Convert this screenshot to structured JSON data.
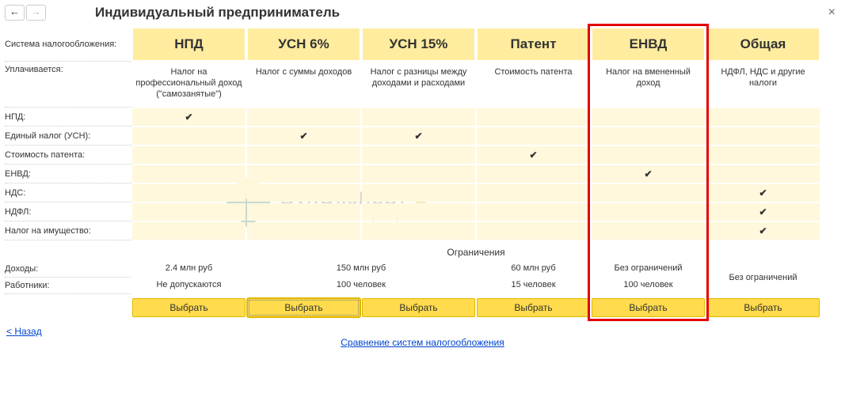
{
  "nav": {
    "back": "←",
    "fwd": "→"
  },
  "title": "Индивидуальный предприниматель",
  "close": "×",
  "row_labels": {
    "system": "Система налогообложения:",
    "paid": "Уплачивается:",
    "npd": "НПД:",
    "usn": "Единый налог (УСН):",
    "patent_cost": "Стоимость патента:",
    "envd": "ЕНВД:",
    "nds": "НДС:",
    "ndfl": "НДФЛ:",
    "property": "Налог на имущество:",
    "income": "Доходы:",
    "workers": "Работники:"
  },
  "limits_header": "Ограничения",
  "columns": [
    {
      "id": "npd",
      "header": "НПД",
      "desc": "Налог на профессиональный доход (\"самозанятые\")",
      "marks": {
        "npd": true
      },
      "income": "2.4 млн руб",
      "workers": "Не допускаются",
      "btn": "Выбрать"
    },
    {
      "id": "usn6",
      "header": "УСН 6%",
      "desc": "Налог с суммы доходов",
      "marks": {
        "usn": true
      },
      "income": "150 млн руб",
      "workers": "100 человек",
      "btn": "Выбрать"
    },
    {
      "id": "usn15",
      "header": "УСН 15%",
      "desc": "Налог с разницы между доходами и расходами",
      "marks": {
        "usn": true
      },
      "income": "",
      "workers": "",
      "btn": "Выбрать"
    },
    {
      "id": "patent",
      "header": "Патент",
      "desc": "Стоимость патента",
      "marks": {
        "patent_cost": true
      },
      "income": "60 млн руб",
      "workers": "15 человек",
      "btn": "Выбрать"
    },
    {
      "id": "envd",
      "header": "ЕНВД",
      "desc": "Налог на вмененный доход",
      "marks": {
        "envd": true
      },
      "income": "Без ограничений",
      "workers": "100 человек",
      "btn": "Выбрать"
    },
    {
      "id": "general",
      "header": "Общая",
      "desc": "НДФЛ, НДС и другие налоги",
      "marks": {
        "nds": true,
        "ndfl": true,
        "property": true
      },
      "income": "Без ограничений",
      "workers": "",
      "btn": "Выбрать"
    }
  ],
  "back_link": "< Назад",
  "compare_link": "Сравнение систем налогообложения",
  "watermark": {
    "brand": "БухЭксперт",
    "num": "8",
    "sub": "База ответов по учёту в 1С"
  }
}
